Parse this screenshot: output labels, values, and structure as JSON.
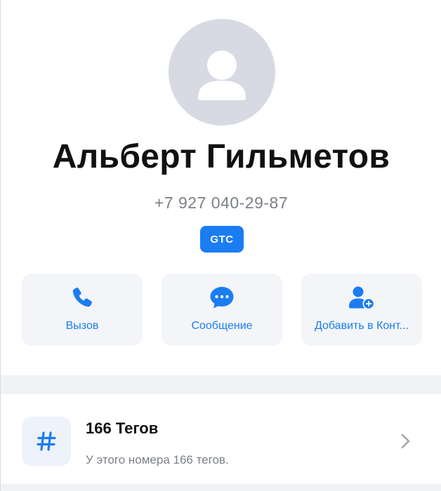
{
  "contact": {
    "name": "Альберт Гильметов",
    "phone": "+7 927 040-29-87",
    "operator_badge": "GTC",
    "avatar_icon": "person-silhouette-icon"
  },
  "actions": [
    {
      "label": "Вызов",
      "icon": "phone-icon"
    },
    {
      "label": "Сообщение",
      "icon": "chat-bubble-icon"
    },
    {
      "label": "Добавить в Конт...",
      "icon": "add-contact-icon"
    }
  ],
  "tags_row": {
    "title": "166 Тегов",
    "subtitle": "У этого номера 166 тегов.",
    "icon": "hashtag-icon"
  },
  "colors": {
    "accent": "#1a7df2",
    "avatar_bg": "#d7d9e3",
    "action_bg": "#f4f5f9",
    "muted_text": "#7b7f87"
  }
}
